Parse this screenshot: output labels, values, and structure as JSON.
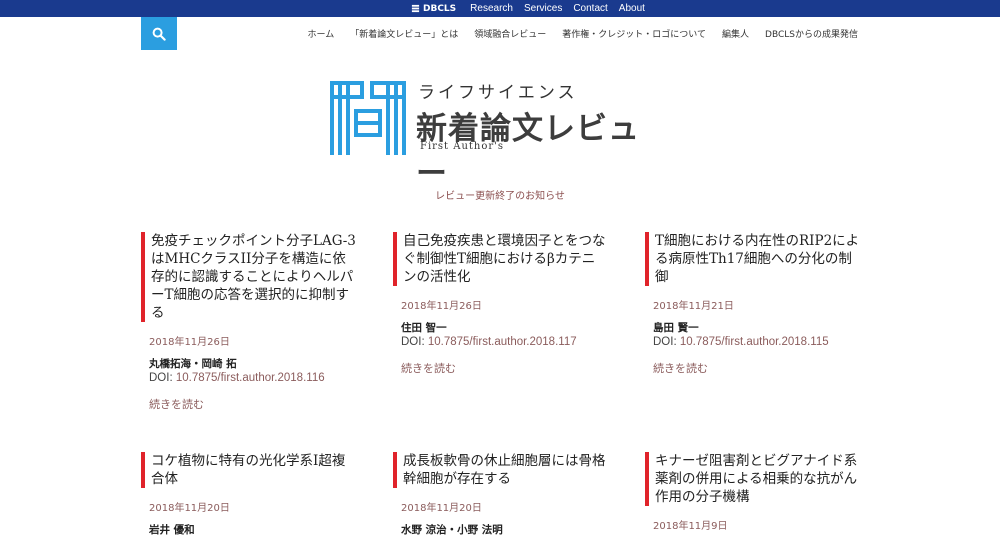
{
  "topbar": {
    "logo_text": "DBCLS",
    "links": [
      "Research",
      "Services",
      "Contact",
      "About"
    ],
    "bg_color": "#1a3a8e"
  },
  "search": {
    "icon": "search-icon",
    "bg_color": "#2b9ee0"
  },
  "nav": [
    "ホーム",
    "「新着論文レビュー」とは",
    "領域融合レビュー",
    "著作権・クレジット・ロゴについて",
    "編集人",
    "DBCLSからの成果発信"
  ],
  "site_logo": {
    "sub": "ライフサイエンス",
    "main": "新着論文レビュー",
    "english": "First Author's"
  },
  "notice": "レビュー更新終了のお知らせ",
  "articles": [
    {
      "title": "免疫チェックポイント分子LAG-3はMHCクラスII分子を構造に依存的に認識することによりヘルパーT細胞の応答を選択的に抑制する",
      "date": "2018年11月26日",
      "authors": "丸橋拓海・岡崎 拓",
      "doi_label": "DOI: ",
      "doi": "10.7875/first.author.2018.116",
      "more": "続きを読む"
    },
    {
      "title": "自己免疫疾患と環境因子とをつなぐ制御性T細胞におけるβカテニンの活性化",
      "date": "2018年11月26日",
      "authors": "住田 智一",
      "doi_label": "DOI: ",
      "doi": "10.7875/first.author.2018.117",
      "more": "続きを読む"
    },
    {
      "title": "T細胞における内在性のRIP2による病原性Th17細胞への分化の制御",
      "date": "2018年11月21日",
      "authors": "島田 賢一",
      "doi_label": "DOI: ",
      "doi": "10.7875/first.author.2018.115",
      "more": "続きを読む"
    },
    {
      "title": "コケ植物に特有の光化学系I超複合体",
      "date": "2018年11月20日",
      "authors": "岩井 優和",
      "doi_label": "",
      "doi": "",
      "more": ""
    },
    {
      "title": "成長板軟骨の休止細胞層には骨格幹細胞が存在する",
      "date": "2018年11月20日",
      "authors": "水野 涼治・小野 法明",
      "doi_label": "",
      "doi": "",
      "more": ""
    },
    {
      "title": "キナーゼ阻害剤とビグアナイド系薬剤の併用による相乗的な抗がん作用の分子機構",
      "date": "2018年11月9日",
      "authors": "",
      "doi_label": "",
      "doi": "",
      "more": ""
    }
  ],
  "colors": {
    "accent_red": "#e0232a",
    "link_brown": "#8b5c5c"
  }
}
